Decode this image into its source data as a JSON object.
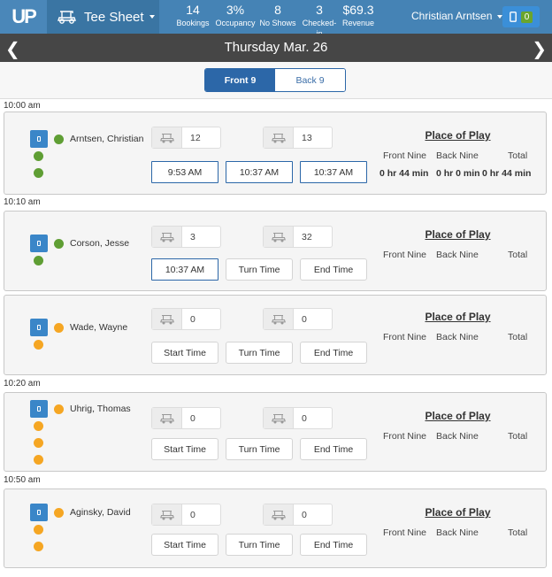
{
  "header": {
    "logo": "UP",
    "module": "Tee Sheet",
    "module_icon": "golf-cart-icon",
    "stats": [
      {
        "value": "14",
        "label": "Bookings"
      },
      {
        "value": "3%",
        "label": "Occupancy"
      },
      {
        "value": "8",
        "label": "No Shows"
      },
      {
        "value": "3",
        "label": "Checked-in"
      },
      {
        "value": "$69.3",
        "label": "Revenue"
      }
    ],
    "user": "Christian Arntsen",
    "device_icon": "mobile-device-icon",
    "device_count": "0",
    "colors": {
      "bar": "#4583b5",
      "accent": "#2c67a8",
      "badge": "#6aa52d"
    }
  },
  "datebar": {
    "title": "Thursday Mar. 26",
    "prev_icon": "chevron-left-icon",
    "next_icon": "chevron-right-icon"
  },
  "tabs": [
    {
      "label": "Front 9",
      "active": true
    },
    {
      "label": "Back 9",
      "active": false
    }
  ],
  "place_of_play": {
    "title": "Place of Play",
    "front": "Front Nine",
    "back": "Back Nine",
    "total": "Total"
  },
  "buttons": {
    "start": "Start Time",
    "turn": "Turn Time",
    "end": "End Time"
  },
  "groups": [
    {
      "time": "10:00 am",
      "player": "Arntsen, Christian",
      "status": "green",
      "dots": 3,
      "cart1": "12",
      "cart2": "13",
      "start": "9:53 AM",
      "turn": "10:37 AM",
      "end": "10:37 AM",
      "front_time": "0 hr 44 min",
      "back_time": "0 hr 0 min",
      "total_time": "0 hr 44 min"
    },
    {
      "time": "10:10 am",
      "player": "Corson, Jesse",
      "status": "green",
      "dots": 2,
      "cart1": "3",
      "cart2": "32",
      "start": "10:37 AM",
      "turn": "Turn Time",
      "end": "End Time"
    },
    {
      "time": "",
      "player": "Wade, Wayne",
      "status": "orange",
      "dots": 2,
      "cart1": "0",
      "cart2": "0",
      "start": "Start Time",
      "turn": "Turn Time",
      "end": "End Time"
    },
    {
      "time": "10:20 am",
      "player": "Uhrig, Thomas",
      "status": "orange",
      "dots": 4,
      "cart1": "0",
      "cart2": "0",
      "start": "Start Time",
      "turn": "Turn Time",
      "end": "End Time"
    },
    {
      "time": "10:50 am",
      "player": "Aginsky, David",
      "status": "orange",
      "dots": 3,
      "cart1": "0",
      "cart2": "0",
      "start": "Start Time",
      "turn": "Turn Time",
      "end": "End Time"
    }
  ]
}
